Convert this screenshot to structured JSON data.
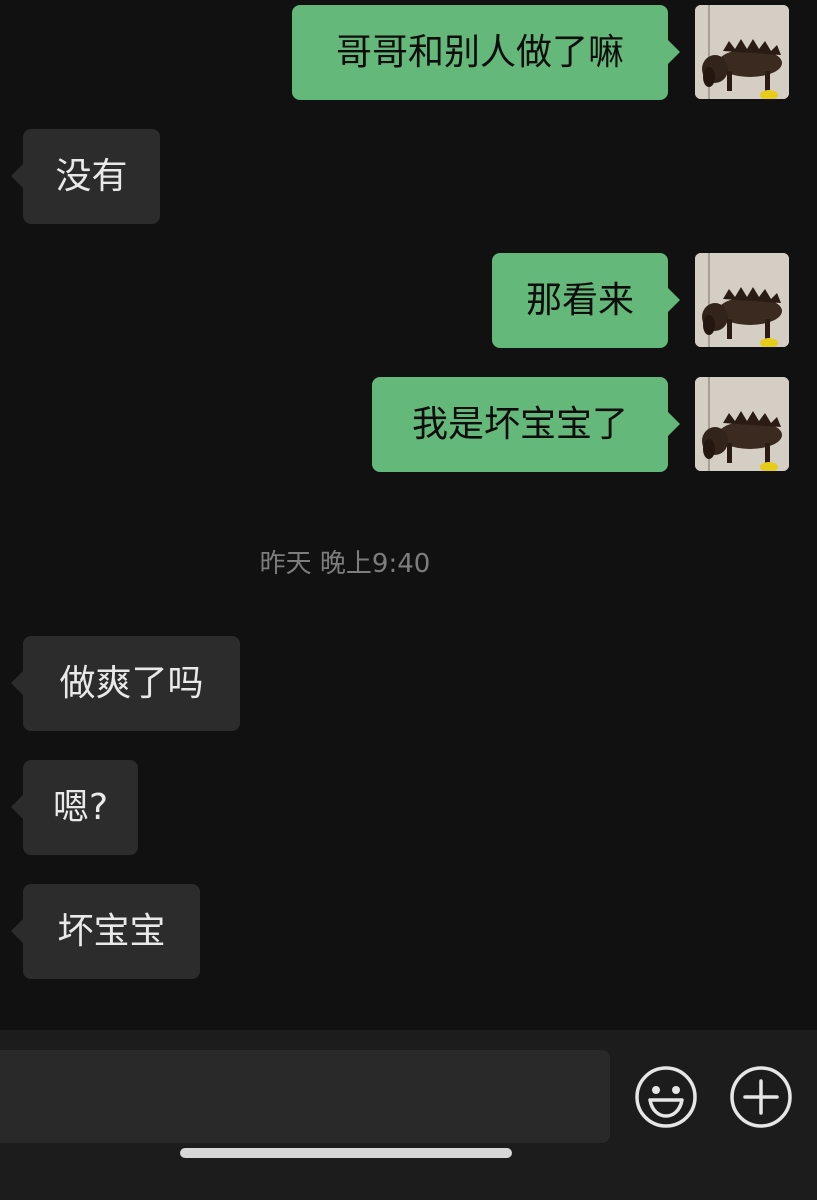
{
  "messages": [
    {
      "side": "me",
      "text": "哥哥和别人做了嘛"
    },
    {
      "side": "them",
      "text": "没有"
    },
    {
      "side": "me",
      "text": "那看来"
    },
    {
      "side": "me",
      "text": "我是坏宝宝了"
    },
    {
      "side": "them",
      "text": "做爽了吗"
    },
    {
      "side": "them",
      "text": "嗯?"
    },
    {
      "side": "them",
      "text": "坏宝宝"
    }
  ],
  "timestamp": "昨天 晚上9:40",
  "input": {
    "value": "",
    "emoji_icon": "emoji-smile-icon",
    "more_icon": "plus-circle-icon"
  },
  "avatar": {
    "icon": "dog-photo-avatar"
  },
  "colors": {
    "background": "#111111",
    "my_bubble": "#64b879",
    "their_bubble": "#2c2c2c",
    "timestamp_text": "#7d7d7d",
    "input_bar": "#1c1c1c"
  }
}
